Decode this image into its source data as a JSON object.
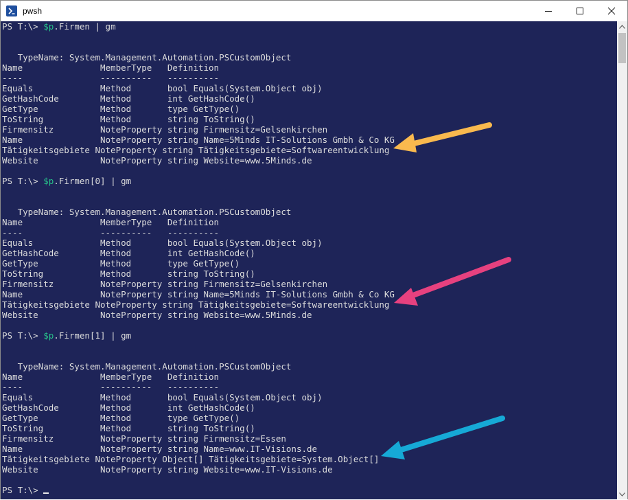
{
  "window": {
    "title": "pwsh"
  },
  "terminal": {
    "lines": [
      {
        "prompt": "PS T:\\> ",
        "var": "$p",
        "rest": ".Firmen | gm"
      },
      {
        "text": ""
      },
      {
        "text": ""
      },
      {
        "text": "   TypeName: System.Management.Automation.PSCustomObject"
      },
      {
        "text": "Name               MemberType   Definition"
      },
      {
        "text": "----               ----------   ----------"
      },
      {
        "text": "Equals             Method       bool Equals(System.Object obj)"
      },
      {
        "text": "GetHashCode        Method       int GetHashCode()"
      },
      {
        "text": "GetType            Method       type GetType()"
      },
      {
        "text": "ToString           Method       string ToString()"
      },
      {
        "text": "Firmensitz         NoteProperty string Firmensitz=Gelsenkirchen"
      },
      {
        "text": "Name               NoteProperty string Name=5Minds IT-Solutions Gmbh & Co KG"
      },
      {
        "text": "Tätigkeitsgebiete NoteProperty string Tätigkeitsgebiete=Softwareentwicklung"
      },
      {
        "text": "Website            NoteProperty string Website=www.5Minds.de"
      },
      {
        "text": ""
      },
      {
        "prompt": "PS T:\\> ",
        "var": "$p",
        "rest": ".Firmen[0] | gm"
      },
      {
        "text": ""
      },
      {
        "text": ""
      },
      {
        "text": "   TypeName: System.Management.Automation.PSCustomObject"
      },
      {
        "text": "Name               MemberType   Definition"
      },
      {
        "text": "----               ----------   ----------"
      },
      {
        "text": "Equals             Method       bool Equals(System.Object obj)"
      },
      {
        "text": "GetHashCode        Method       int GetHashCode()"
      },
      {
        "text": "GetType            Method       type GetType()"
      },
      {
        "text": "ToString           Method       string ToString()"
      },
      {
        "text": "Firmensitz         NoteProperty string Firmensitz=Gelsenkirchen"
      },
      {
        "text": "Name               NoteProperty string Name=5Minds IT-Solutions Gmbh & Co KG"
      },
      {
        "text": "Tätigkeitsgebiete NoteProperty string Tätigkeitsgebiete=Softwareentwicklung"
      },
      {
        "text": "Website            NoteProperty string Website=www.5Minds.de"
      },
      {
        "text": ""
      },
      {
        "prompt": "PS T:\\> ",
        "var": "$p",
        "rest": ".Firmen[1] | gm"
      },
      {
        "text": ""
      },
      {
        "text": ""
      },
      {
        "text": "   TypeName: System.Management.Automation.PSCustomObject"
      },
      {
        "text": "Name               MemberType   Definition"
      },
      {
        "text": "----               ----------   ----------"
      },
      {
        "text": "Equals             Method       bool Equals(System.Object obj)"
      },
      {
        "text": "GetHashCode        Method       int GetHashCode()"
      },
      {
        "text": "GetType            Method       type GetType()"
      },
      {
        "text": "ToString           Method       string ToString()"
      },
      {
        "text": "Firmensitz         NoteProperty string Firmensitz=Essen"
      },
      {
        "text": "Name               NoteProperty string Name=www.IT-Visions.de"
      },
      {
        "text": "Tätigkeitsgebiete NoteProperty Object[] Tätigkeitsgebiete=System.Object[]"
      },
      {
        "text": "Website            NoteProperty string Website=www.IT-Visions.de"
      },
      {
        "text": ""
      },
      {
        "prompt": "PS T:\\> ",
        "cursor": true
      }
    ]
  },
  "colors": {
    "background": "#1e2458",
    "text": "#dcdcdc",
    "variable": "#27c48b",
    "arrow_1": "#f9b94e",
    "arrow_2": "#e6417f",
    "arrow_3": "#16a9d6"
  }
}
